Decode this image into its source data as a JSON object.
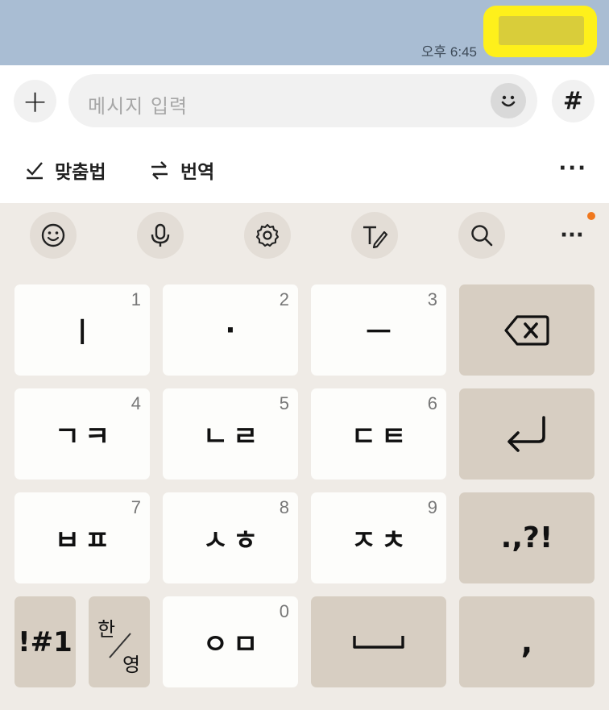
{
  "chat": {
    "timestamp": "오후 6:45"
  },
  "input": {
    "placeholder": "메시지 입력",
    "plus_label": "+",
    "hash_label": "#"
  },
  "tools": {
    "spellcheck_label": "맞춤법",
    "translate_label": "번역",
    "more_label": "···"
  },
  "keyboard_toolbar": {
    "more_label": "···"
  },
  "keys": {
    "row1": [
      {
        "main": "ㅣ",
        "num": "1"
      },
      {
        "main": "·",
        "num": "2"
      },
      {
        "main": "ㅡ",
        "num": "3"
      }
    ],
    "row2": [
      {
        "main": "ㄱㅋ",
        "num": "4"
      },
      {
        "main": "ㄴㄹ",
        "num": "5"
      },
      {
        "main": "ㄷㅌ",
        "num": "6"
      }
    ],
    "row3": [
      {
        "main": "ㅂㅍ",
        "num": "7"
      },
      {
        "main": "ㅅㅎ",
        "num": "8"
      },
      {
        "main": "ㅈㅊ",
        "num": "9"
      }
    ],
    "punct": ".,?!",
    "symbols": "!#1",
    "lang_top": "한",
    "lang_bottom": "영",
    "zero": {
      "main": "ㅇㅁ",
      "num": "0"
    },
    "comma": ","
  },
  "colors": {
    "chat_bg": "#a9bdd3",
    "bubble": "#fef01b",
    "keyboard_bg": "#efebe6",
    "gray_key": "#d7cec2",
    "notification_dot": "#f0781e"
  }
}
